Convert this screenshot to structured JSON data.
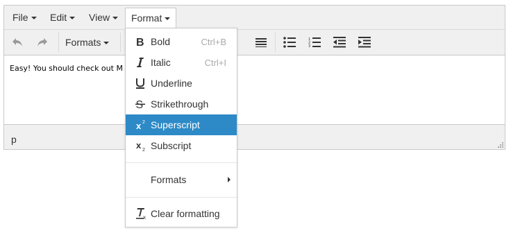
{
  "menubar": {
    "items": [
      {
        "label": "File"
      },
      {
        "label": "Edit"
      },
      {
        "label": "View"
      },
      {
        "label": "Format"
      }
    ]
  },
  "toolbar": {
    "formats_label": "Formats",
    "buttons": [
      "undo-icon",
      "redo-icon",
      "align-justify-icon",
      "bullet-list-icon",
      "numbered-list-icon",
      "outdent-icon",
      "indent-icon"
    ]
  },
  "content": {
    "text": "Easy! You should check out M"
  },
  "statusbar": {
    "path": "p"
  },
  "format_menu": {
    "items": [
      {
        "label": "Bold",
        "shortcut": "Ctrl+B",
        "icon": "B"
      },
      {
        "label": "Italic",
        "shortcut": "Ctrl+I",
        "icon": "I"
      },
      {
        "label": "Underline",
        "icon": "U"
      },
      {
        "label": "Strikethrough",
        "icon": "S"
      },
      {
        "label": "Superscript",
        "icon": "x2"
      },
      {
        "label": "Subscript",
        "icon": "x2"
      },
      {
        "label": "Formats"
      },
      {
        "label": "Clear formatting",
        "icon": "Tx"
      }
    ],
    "highlight_color": "#2d8ac7"
  }
}
